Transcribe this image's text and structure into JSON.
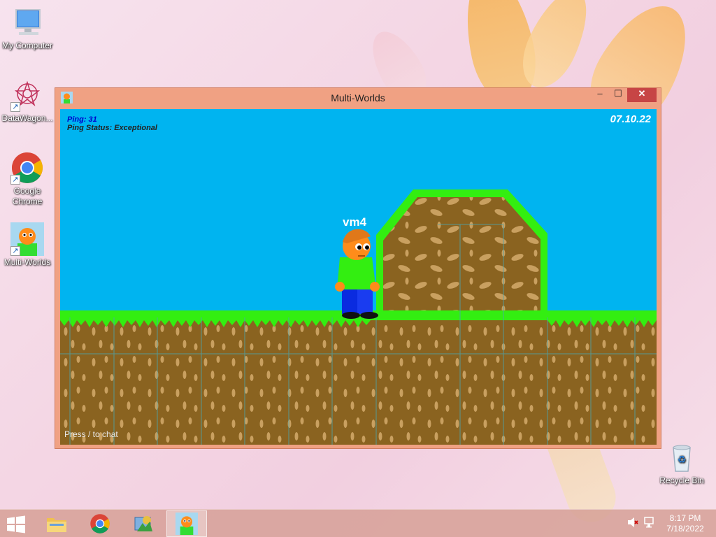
{
  "desktop": {
    "icons": [
      {
        "label": "My Computer"
      },
      {
        "label": "DataWagon..."
      },
      {
        "label": "Google Chrome"
      },
      {
        "label": "Multi-Worlds"
      },
      {
        "label": "Recycle Bin"
      }
    ]
  },
  "window": {
    "title": "Multi-Worlds",
    "controls": {
      "minimize": "–",
      "maximize": "☐",
      "close": "✕"
    }
  },
  "game": {
    "ping_text": "Ping: 31",
    "ping_status_text": "Ping Status: Exceptional",
    "date": "07.10.22",
    "player_name": "vm4",
    "chat_hint": "Press / to chat",
    "colors": {
      "sky": "#00b4f0",
      "grass": "#33ee11",
      "dirt": "#8a6320",
      "dirt_spot": "#c9a060"
    }
  },
  "taskbar": {
    "items": [
      "start-button",
      "file-explorer",
      "google-chrome",
      "system-tool",
      "multi-worlds"
    ],
    "clock": {
      "time": "8:17 PM",
      "date": "7/18/2022"
    }
  }
}
